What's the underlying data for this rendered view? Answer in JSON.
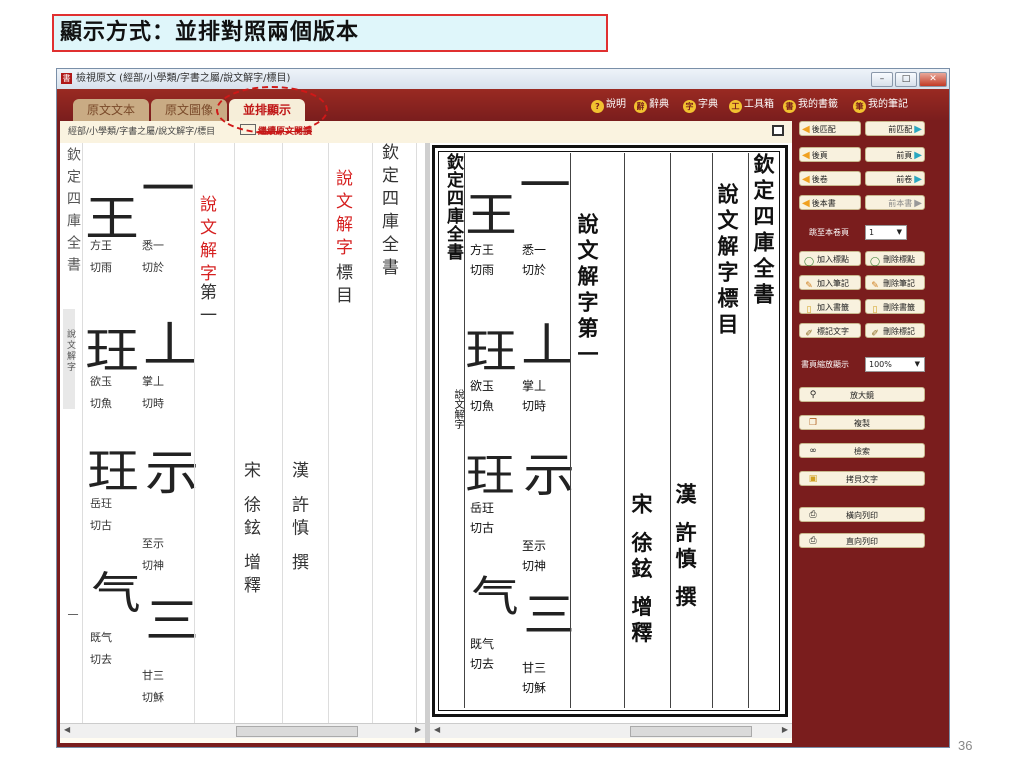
{
  "slide": {
    "title": "顯示方式：並排對照兩個版本",
    "page_number": "36"
  },
  "window": {
    "title": "檢視原文 (經部/小學類/字書之屬/說文解字/標目)",
    "controls": [
      "–",
      "□",
      "✕"
    ]
  },
  "tabs": [
    {
      "label": "原文文本",
      "active": false
    },
    {
      "label": "原文圖像",
      "active": false
    },
    {
      "label": "並排顯示",
      "active": true
    }
  ],
  "tools": [
    {
      "icon": "help-icon",
      "glyph": "?",
      "label": "說明"
    },
    {
      "icon": "dictionary-icon",
      "glyph": "辭",
      "label": "辭典"
    },
    {
      "icon": "character-dictionary-icon",
      "glyph": "字",
      "label": "字典"
    },
    {
      "icon": "toolbox-icon",
      "glyph": "工",
      "label": "工具箱"
    },
    {
      "icon": "bookmark-icon",
      "glyph": "書",
      "label": "我的書籤"
    },
    {
      "icon": "notes-icon",
      "glyph": "筆",
      "label": "我的筆記"
    }
  ],
  "path_bar": {
    "path": "經部/小學類/字書之屬/說文解字/標目",
    "original_link": "繼續原文閱讀"
  },
  "text_pane": {
    "side_text_top": "欽定四庫全書",
    "side_text_bottom": "說文解字",
    "side_dash": "一",
    "columns": [
      {
        "text": "欽定四庫全書",
        "red": false
      },
      {
        "text": "說文解字",
        "red": true
      },
      {
        "text": "標目",
        "red": false
      },
      {
        "text": "漢 許慎 撰",
        "red": false
      },
      {
        "text": "宋 徐鉉 增釋",
        "red": false
      },
      {
        "text": "說文解字",
        "red": true
      },
      {
        "text": "第一",
        "red": false
      }
    ],
    "seal_chars": [
      "一",
      "王",
      "丄",
      "玨",
      "示",
      "气",
      "三"
    ],
    "annotations": [
      "悉一",
      "切於",
      "方王",
      "切雨",
      "掌丄",
      "切時",
      "欲玉",
      "切魚",
      "至示",
      "切神",
      "岳玨",
      "切古",
      "甘三",
      "切穌",
      "既气",
      "切去"
    ]
  },
  "scan_pane": {
    "columns": [
      "欽定四庫全書",
      "說文解字標目",
      "漢 許慎 撰",
      "宋 徐鉉 增釋",
      "說文解字第一"
    ],
    "side_label": "欽定四庫全書",
    "side_label2": "說文解字"
  },
  "right_panel": {
    "nav_buttons": [
      {
        "left": "後匹配",
        "right": "前匹配"
      },
      {
        "left": "後頁",
        "right": "前頁"
      },
      {
        "left": "後卷",
        "right": "前卷"
      },
      {
        "left": "後本書",
        "right": "前本書"
      }
    ],
    "jump_label": "跳至本卷頁",
    "jump_value": "1",
    "action_buttons": [
      {
        "left": "加入標點",
        "right": "刪除標點"
      },
      {
        "left": "加入筆記",
        "right": "刪除筆記"
      },
      {
        "left": "加入書籤",
        "right": "刪除書籤"
      },
      {
        "left": "標記文字",
        "right": "刪除標記"
      }
    ],
    "zoom_label": "書頁縮放顯示",
    "zoom_value": "100%",
    "wide_buttons": [
      "放大鏡",
      "複製",
      "檢索",
      "拷貝文字",
      "橫向列印",
      "直向列印"
    ]
  },
  "colors": {
    "window_bg": "#7a1d1d",
    "highlight": "#d01818",
    "title_box_border": "#e03030",
    "title_box_bg": "#dff6fa"
  }
}
